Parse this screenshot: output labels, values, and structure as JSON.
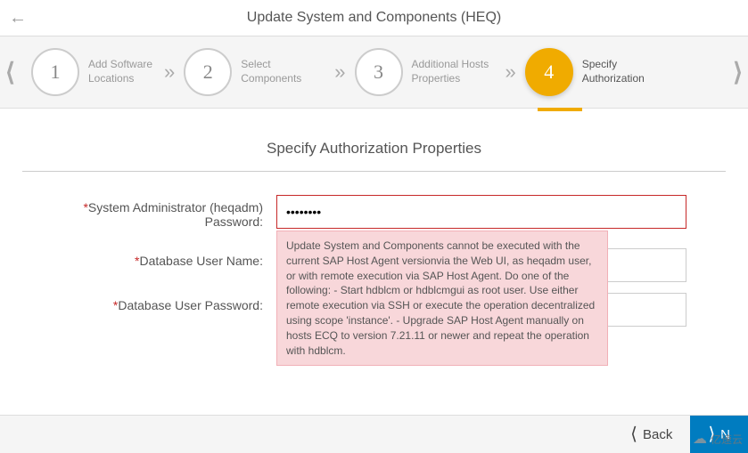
{
  "header": {
    "title": "Update System and Components (HEQ)"
  },
  "wizard": {
    "steps": [
      {
        "num": "1",
        "label": "Add Software Locations"
      },
      {
        "num": "2",
        "label": "Select Components"
      },
      {
        "num": "3",
        "label": "Additional Hosts Properties"
      },
      {
        "num": "4",
        "label": "Specify Authorization"
      }
    ],
    "active_index": 3
  },
  "section": {
    "title": "Specify Authorization Properties"
  },
  "form": {
    "sys_admin_pw_label": "System Administrator (heqadm) Password:",
    "sys_admin_pw_value": "••••••••",
    "db_user_label": "Database User Name:",
    "db_user_value": "",
    "db_user_pw_label": "Database User Password:",
    "db_user_pw_value": ""
  },
  "error_tooltip": {
    "text": "Update System and Components cannot be executed with the current SAP Host Agent versionvia the Web UI, as heqadm user, or with remote execution via SAP Host Agent. Do one of the following: - Start hdblcm or hdblcmgui as root user. Use either remote execution via SSH or execute the operation decentralized using scope 'instance'. - Upgrade SAP Host Agent manually on hosts ECQ to version 7.21.11 or newer and repeat the operation with hdblcm."
  },
  "footer": {
    "back_label": "Back",
    "next_label": "N"
  },
  "watermark": {
    "text": "亿速云"
  }
}
